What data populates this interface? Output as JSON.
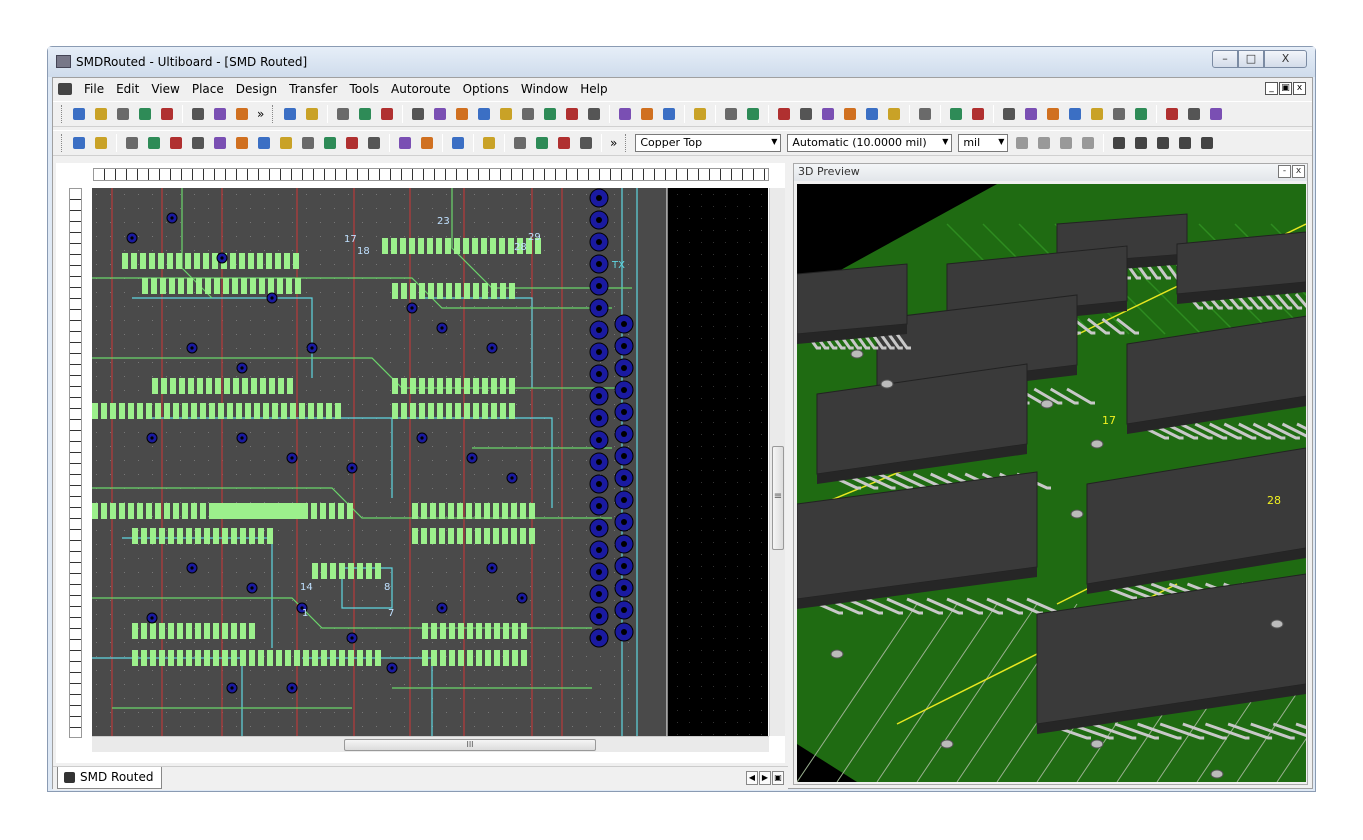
{
  "window": {
    "title": "SMDRouted - Ultiboard - [SMD Routed]",
    "controls": {
      "minimize": "–",
      "maximize": "□",
      "close": "X"
    }
  },
  "menu": {
    "items": [
      "File",
      "Edit",
      "View",
      "Place",
      "Design",
      "Transfer",
      "Tools",
      "Autoroute",
      "Options",
      "Window",
      "Help"
    ],
    "mdi_controls": {
      "minimize": "_",
      "restore": "▣",
      "close": "x"
    }
  },
  "toolbar": {
    "overflow": "»",
    "layer_select": "Copper Top",
    "trace_width_select": "Automatic (10.0000 mil)",
    "units_select": "mil"
  },
  "icons": {
    "row1": [
      "new-file-icon",
      "open-icon",
      "open-folder-icon",
      "save-icon",
      "print-icon",
      "cut-icon",
      "copy-icon",
      "paste-icon",
      "select-icon",
      "spreadsheet-icon",
      "table-icon",
      "netlist-icon",
      "place-part-icon",
      "place-component-icon",
      "place-block-icon",
      "draw-trace-icon",
      "draw-trace2-icon",
      "draw-trace3-icon",
      "draw-trace4-icon",
      "draw-trace5-icon",
      "draw-trace6-icon",
      "route-icon",
      "autoroute-icon",
      "autoplace-icon",
      "selection-icon",
      "help-icon",
      "refresh-icon",
      "view-icon",
      "zoom-in-icon",
      "zoom-out-icon",
      "zoom-window-icon",
      "zoom-fit-icon",
      "ratsnest-icon",
      "ratsnest2-icon",
      "ratsnest3-icon",
      "ratsnest4-icon",
      "ratsnest5-icon",
      "filter-icon",
      "filter2-icon",
      "filter3-icon",
      "filter4-icon",
      "filter5-icon",
      "filter6-icon",
      "filter7-icon",
      "filter8-icon",
      "3d-icon",
      "3d-part-icon"
    ],
    "row2": [
      "select-arrow-icon",
      "select-box-icon",
      "pointer-icon",
      "line-icon",
      "line2-icon",
      "line3-icon",
      "line4-icon",
      "line5-icon",
      "line6-icon",
      "line7-icon",
      "line8-icon",
      "line9-icon",
      "line10-icon",
      "line11-icon",
      "trace-icon",
      "trace2-icon",
      "copper-icon",
      "via-icon",
      "text-icon",
      "text2-icon",
      "text3-icon",
      "board-icon"
    ]
  },
  "colors": {
    "board": "#4a4a4a",
    "pad": "#9cf08c",
    "via": "#1a1aa0",
    "trace_red": "#b83a3a",
    "trace_cyan": "#5fd5e0",
    "trace_green": "#6bd56b",
    "preview_board": "#1f6b12",
    "chip": "#3a3a3a"
  },
  "pcb_labels": [
    "23",
    "17",
    "28",
    "18",
    "29",
    "TX",
    "8",
    "7",
    "1",
    "14"
  ],
  "preview": {
    "title": "3D Preview",
    "controls": {
      "pin": "-",
      "close": "x"
    },
    "labels": [
      "17",
      "28"
    ]
  },
  "document_tabs": [
    {
      "label": "SMD Routed"
    }
  ],
  "scrollbar": {
    "grip": "≡",
    "hgrip": "III"
  }
}
